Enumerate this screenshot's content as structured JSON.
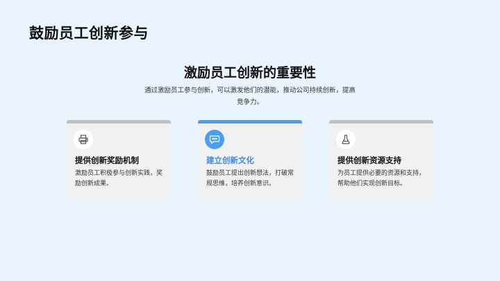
{
  "slide": {
    "title": "鼓励员工创新参与",
    "heading": "激励员工创新的重要性",
    "subtitle": "通过激励员工参与创新，可以激发他们的潜能，推动公司持续创新，提高竞争力。"
  },
  "cards": [
    {
      "icon": "printer-icon",
      "title": "提供创新奖励机制",
      "description": "激励员工积极参与创新实践，奖励创新成果。",
      "active": false
    },
    {
      "icon": "chat-bubble-icon",
      "title": "建立创新文化",
      "description": "鼓励员工提出创新想法，打破常规思维，培养创新意识。",
      "active": true
    },
    {
      "icon": "flask-icon",
      "title": "提供创新资源支持",
      "description": "为员工提供必要的资源和支持，帮助他们实现创新目标。",
      "active": false
    }
  ],
  "colors": {
    "background": "#eaf4fe",
    "accent": "#4a9ff0",
    "card": "#f1f1f1"
  }
}
